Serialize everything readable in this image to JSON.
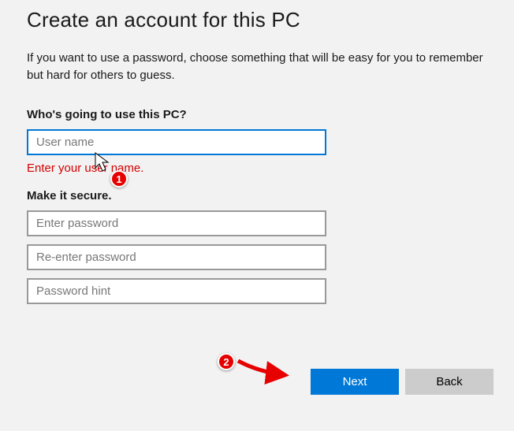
{
  "header": {
    "title": "Create an account for this PC",
    "description": "If you want to use a password, choose something that will be easy for you to remember but hard for others to guess."
  },
  "user_section": {
    "label": "Who's going to use this PC?",
    "username_placeholder": "User name",
    "username_value": "",
    "error": "Enter your user name."
  },
  "secure_section": {
    "label": "Make it secure.",
    "password_placeholder": "Enter password",
    "reenter_placeholder": "Re-enter password",
    "hint_placeholder": "Password hint"
  },
  "buttons": {
    "next": "Next",
    "back": "Back"
  },
  "annotations": {
    "marker1": "1",
    "marker2": "2"
  }
}
